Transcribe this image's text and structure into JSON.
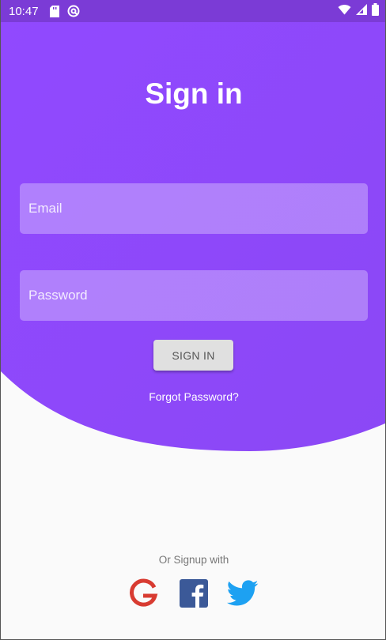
{
  "status_bar": {
    "time": "10:47"
  },
  "title": "Sign in",
  "form": {
    "email_placeholder": "Email",
    "password_placeholder": "Password",
    "signin_label": "SIGN IN",
    "forgot_label": "Forgot Password?"
  },
  "social": {
    "caption": "Or Signup with",
    "providers": [
      "google-icon",
      "facebook-icon",
      "twitter-icon"
    ]
  },
  "colors": {
    "primary": "#9147ff",
    "status_bar": "#7b3bd6",
    "background": "#fafafa",
    "google": "#d83b31",
    "facebook": "#3b5998",
    "twitter": "#1da1f2"
  }
}
